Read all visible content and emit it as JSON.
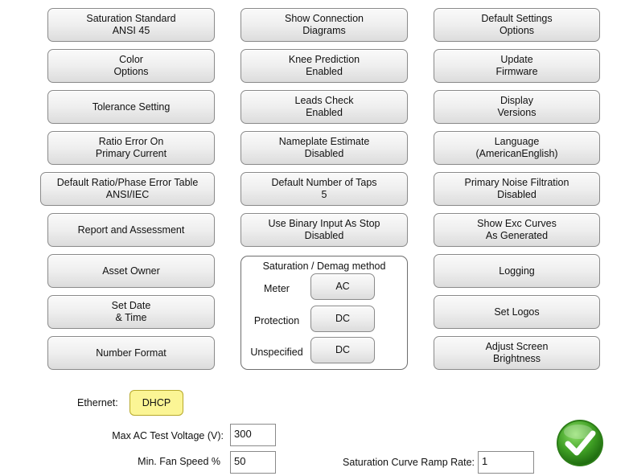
{
  "column1": [
    {
      "line1": "Saturation Standard",
      "line2": "ANSI 45"
    },
    {
      "line1": "Color",
      "line2": "Options"
    },
    {
      "line1": "Tolerance Setting",
      "line2": ""
    },
    {
      "line1": "Ratio Error On",
      "line2": "Primary Current"
    },
    {
      "line1": "Default Ratio/Phase Error Table",
      "line2": "ANSI/IEC"
    },
    {
      "line1": "Report and Assessment",
      "line2": ""
    },
    {
      "line1": "Asset Owner",
      "line2": ""
    },
    {
      "line1": "Set Date",
      "line2": "& Time"
    },
    {
      "line1": "Number Format",
      "line2": ""
    }
  ],
  "column2": [
    {
      "line1": "Show Connection",
      "line2": "Diagrams"
    },
    {
      "line1": "Knee Prediction",
      "line2": "Enabled"
    },
    {
      "line1": "Leads Check",
      "line2": "Enabled"
    },
    {
      "line1": "Nameplate Estimate",
      "line2": "Disabled"
    },
    {
      "line1": "Default Number of Taps",
      "line2": "5"
    },
    {
      "line1": "Use Binary Input As Stop",
      "line2": "Disabled"
    }
  ],
  "column3": [
    {
      "line1": "Default Settings",
      "line2": "Options"
    },
    {
      "line1": "Update",
      "line2": "Firmware"
    },
    {
      "line1": "Display",
      "line2": "Versions"
    },
    {
      "line1": "Language",
      "line2": "(AmericanEnglish)"
    },
    {
      "line1": "Primary Noise Filtration",
      "line2": "Disabled"
    },
    {
      "line1": "Show Exc Curves",
      "line2": "As Generated"
    },
    {
      "line1": "Logging",
      "line2": ""
    },
    {
      "line1": "Set Logos",
      "line2": ""
    },
    {
      "line1": "Adjust Screen",
      "line2": "Brightness"
    }
  ],
  "saturation_group": {
    "title": "Saturation / Demag method",
    "rows": [
      {
        "label": "Meter",
        "value": "AC"
      },
      {
        "label": "Protection",
        "value": "DC"
      },
      {
        "label": "Unspecified",
        "value": "DC"
      }
    ]
  },
  "ethernet": {
    "label": "Ethernet:",
    "value": "DHCP"
  },
  "max_ac": {
    "label": "Max AC Test Voltage (V):",
    "value": "300"
  },
  "fan_speed": {
    "label": "Min. Fan Speed %",
    "value": "50"
  },
  "ramp_rate": {
    "label": "Saturation Curve Ramp Rate:",
    "value": "1"
  },
  "colors": {
    "accent_yellow": "#fbf595",
    "check_green": "#3f9f24"
  }
}
